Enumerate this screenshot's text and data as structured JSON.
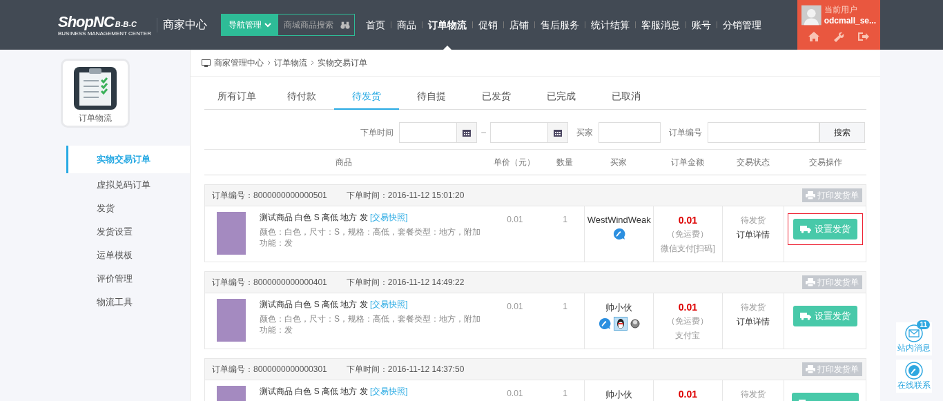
{
  "header": {
    "logo": {
      "name": "ShopNC",
      "suffix": "B-B-C",
      "tagline": "BUSINESS MANAGEMENT CENTER"
    },
    "center_title": "商家中心",
    "nav_button": "导航管理",
    "search": {
      "placeholder": "商城商品搜索"
    },
    "nav": [
      {
        "label": "首页",
        "selected": false
      },
      {
        "label": "商品",
        "selected": false
      },
      {
        "label": "订单物流",
        "selected": true
      },
      {
        "label": "促销",
        "selected": false
      },
      {
        "label": "店铺",
        "selected": false
      },
      {
        "label": "售后服务",
        "selected": false
      },
      {
        "label": "统计结算",
        "selected": false
      },
      {
        "label": "客服消息",
        "selected": false
      },
      {
        "label": "账号",
        "selected": false
      },
      {
        "label": "分销管理",
        "selected": false
      }
    ],
    "user": {
      "label": "当前用户",
      "name": "odcmall_se..."
    }
  },
  "sidebar": {
    "module": "订单物流",
    "items": [
      {
        "label": "实物交易订单",
        "selected": true
      },
      {
        "label": "虚拟兑码订单",
        "selected": false
      },
      {
        "label": "发货",
        "selected": false
      },
      {
        "label": "发货设置",
        "selected": false
      },
      {
        "label": "运单模板",
        "selected": false
      },
      {
        "label": "评价管理",
        "selected": false
      },
      {
        "label": "物流工具",
        "selected": false
      }
    ]
  },
  "breadcrumb": [
    "商家管理中心",
    "订单物流",
    "实物交易订单"
  ],
  "tabs": [
    {
      "label": "所有订单",
      "selected": false
    },
    {
      "label": "待付款",
      "selected": false
    },
    {
      "label": "待发货",
      "selected": true
    },
    {
      "label": "待自提",
      "selected": false
    },
    {
      "label": "已发货",
      "selected": false
    },
    {
      "label": "已完成",
      "selected": false
    },
    {
      "label": "已取消",
      "selected": false
    }
  ],
  "filters": {
    "date_label": "下单时间",
    "separator": "–",
    "buyer_label": "买家",
    "order_no_label": "订单编号",
    "search_button": "搜索"
  },
  "columns": [
    "商品",
    "单价（元）",
    "数量",
    "买家",
    "订单金额",
    "交易状态",
    "交易操作"
  ],
  "orders": [
    {
      "order_no": "订单编号：8000000000000501",
      "time": "下单时间：2016-11-12 15:01:20",
      "print_button": "打印发货单",
      "title": "测试商品 白色 S 高低 地方 发",
      "snapshot": "[交易快照]",
      "spec": "颜色：白色，尺寸：S，规格：高低，套餐类型：地方，附加功能：发",
      "price": "0.01",
      "qty": "1",
      "buyer": "WestWindWeak",
      "contacts": [
        {
          "kind": "wangwang"
        }
      ],
      "amount": "0.01",
      "shipping": "（免运费）",
      "payment": "微信支付[扫码]",
      "status": "待发货",
      "detail": "订单详情",
      "action": "设置发货",
      "highlighted": true
    },
    {
      "order_no": "订单编号：8000000000000401",
      "time": "下单时间：2016-11-12 14:49:22",
      "print_button": "打印发货单",
      "title": "测试商品 白色 S 高低 地方 发",
      "snapshot": "[交易快照]",
      "spec": "颜色：白色，尺寸：S，规格：高低，套餐类型：地方，附加功能：发",
      "price": "0.01",
      "qty": "1",
      "buyer": "帅小伙",
      "contacts": [
        {
          "kind": "wangwang"
        },
        {
          "kind": "qq"
        },
        {
          "kind": "ball"
        }
      ],
      "amount": "0.01",
      "shipping": "（免运费）",
      "payment": "支付宝",
      "status": "待发货",
      "detail": "订单详情",
      "action": "设置发货",
      "highlighted": false
    },
    {
      "order_no": "订单编号：8000000000000301",
      "time": "下单时间：2016-11-12 14:37:50",
      "print_button": "打印发货单",
      "title": "测试商品 白色 S 高低 地方 发",
      "snapshot": "[交易快照]",
      "price": "0.01",
      "qty": "1",
      "buyer": "帅小伙",
      "amount": "0.01",
      "status": "待发货",
      "highlighted": false
    }
  ],
  "float_tools": [
    {
      "kind": "message",
      "label": "站内消息",
      "badge": "11"
    },
    {
      "kind": "contact",
      "label": "在线联系"
    }
  ]
}
